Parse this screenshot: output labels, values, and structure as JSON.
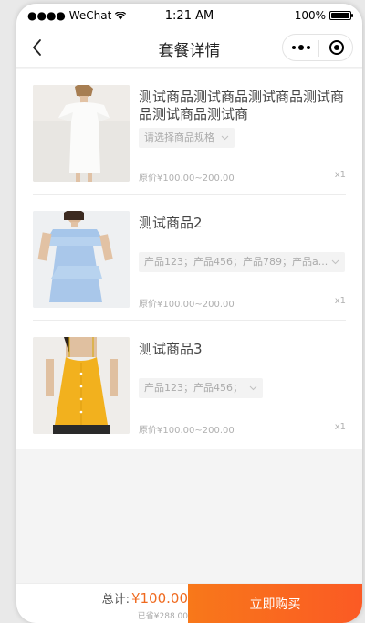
{
  "status_bar": {
    "carrier": "●●●● WeChat",
    "time": "1:21 AM",
    "battery": "100%",
    "battery_level": 1.0
  },
  "nav": {
    "title": "套餐详情"
  },
  "products": [
    {
      "name": "测试商品测试商品测试商品测试商品测试商品测试商",
      "spec": "请选择商品规格",
      "price": "原价¥100.00~200.00",
      "qty": "x1",
      "image": "white-ruffle-dress"
    },
    {
      "name": "测试商品2",
      "spec": "产品123；产品456；产品789；产品a...",
      "price": "原价¥100.00~200.00",
      "qty": "x1",
      "image": "blue-off-shoulder-dress"
    },
    {
      "name": "测试商品3",
      "spec": "产品123；产品456；",
      "price": "原价¥100.00~200.00",
      "qty": "x1",
      "image": "yellow-camisole"
    }
  ],
  "bottom_bar": {
    "total_label": "总计:",
    "total_amount": "¥100.00",
    "saved": "已省¥288.00",
    "buy_label": "立即购买"
  },
  "colors": {
    "accent": "#f8781a",
    "price_highlight": "#ef6a1f"
  }
}
